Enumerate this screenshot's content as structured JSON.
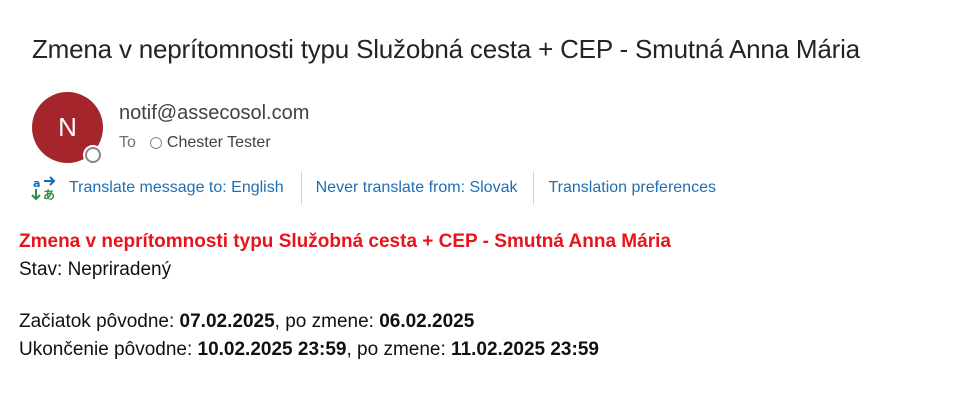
{
  "message": {
    "subject": "Zmena v neprítomnosti typu Služobná cesta + CEP - Smutná Anna Mária",
    "avatar_initial": "N",
    "avatar_color": "#a4262c",
    "sender": "notif@assecosol.com",
    "to_label": "To",
    "recipient": "Chester Tester"
  },
  "translation_bar": {
    "translate_link": "Translate message to: English",
    "never_translate_link": "Never translate from: Slovak",
    "preferences_link": "Translation preferences",
    "link_color": "#1f6fb5"
  },
  "body": {
    "headline": "Zmena v neprítomnosti typu Služobná cesta + CEP - Smutná Anna Mária",
    "headline_color": "#e8141c",
    "status": "Stav: Nepriradený",
    "start_label": "Začiatok pôvodne: ",
    "start_original": "07.02.2025",
    "start_change_label": ", po zmene: ",
    "start_changed": "06.02.2025",
    "end_label": "Ukončenie pôvodne: ",
    "end_original": "10.02.2025 23:59",
    "end_change_label": ", po zmene: ",
    "end_changed": "11.02.2025 23:59"
  }
}
